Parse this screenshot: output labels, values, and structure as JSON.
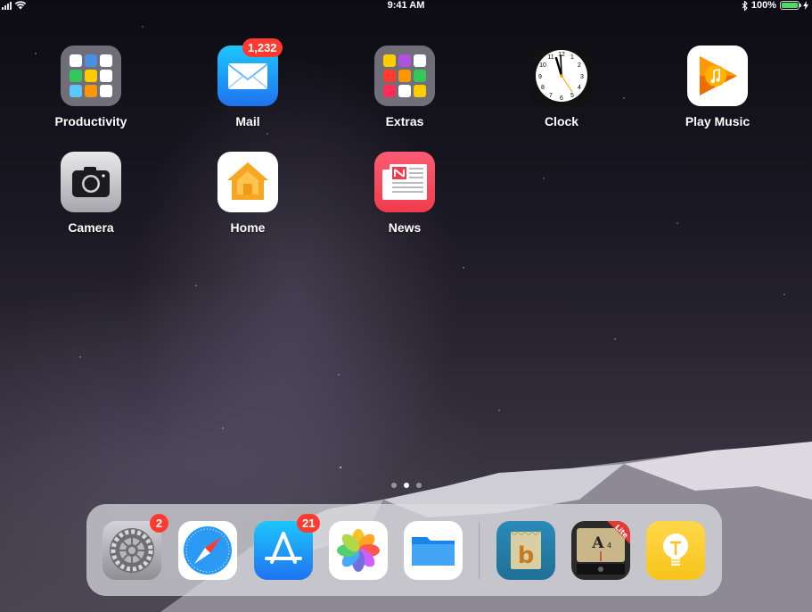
{
  "status_bar": {
    "time": "9:41 AM",
    "battery_percent": "100%",
    "signal-bars": 4
  },
  "home_screen": {
    "apps": [
      {
        "name": "Productivity",
        "icon": "folder-icon"
      },
      {
        "name": "Mail",
        "icon": "mail-icon",
        "badge": "1,232"
      },
      {
        "name": "Extras",
        "icon": "folder-icon"
      },
      {
        "name": "Clock",
        "icon": "clock-icon"
      },
      {
        "name": "Play Music",
        "icon": "play-music-icon"
      },
      {
        "name": "Camera",
        "icon": "camera-icon"
      },
      {
        "name": "Home",
        "icon": "home-icon"
      },
      {
        "name": "News",
        "icon": "news-icon"
      }
    ],
    "page_count": 3,
    "current_page": 2
  },
  "dock": {
    "items": [
      {
        "icon": "settings-icon",
        "badge": "2"
      },
      {
        "icon": "safari-icon"
      },
      {
        "icon": "app-store-icon",
        "badge": "21"
      },
      {
        "icon": "photos-icon"
      },
      {
        "icon": "files-icon"
      },
      {
        "icon": "bobble-app-icon"
      },
      {
        "icon": "tuner-app-icon",
        "ribbon": "Lite"
      },
      {
        "icon": "tips-icon"
      }
    ]
  },
  "colors": {
    "badge": "#ff3b30",
    "battery": "#4cd964",
    "mail_blue": "#2d8cf0",
    "news_red": "#f0505a"
  }
}
